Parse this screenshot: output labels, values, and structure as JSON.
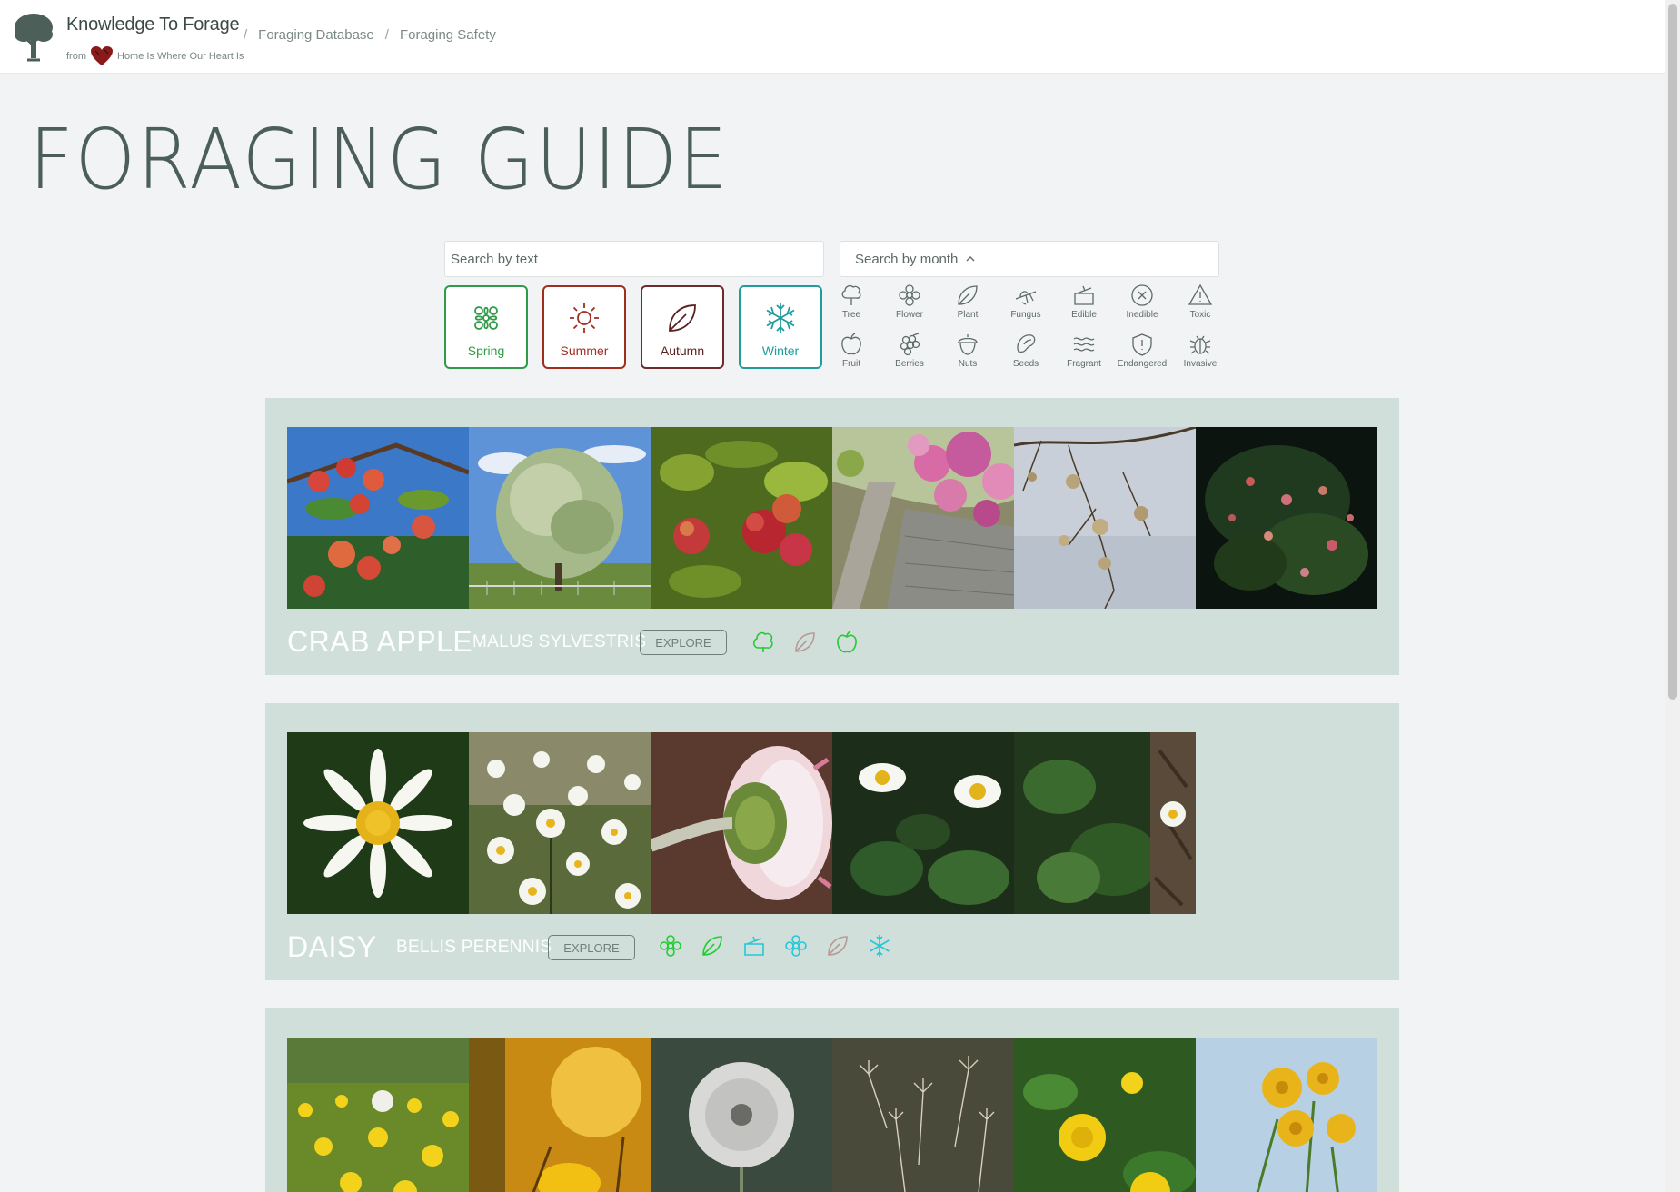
{
  "header": {
    "brand_title": "Knowledge To Forage",
    "brand_from": "from",
    "brand_parent": "Home Is Where Our Heart Is",
    "breadcrumbs": [
      "Foraging Database",
      "Foraging Safety"
    ]
  },
  "page": {
    "title": "FORAGING GUIDE"
  },
  "search": {
    "text_placeholder": "Search by text",
    "month_label": "Search by month"
  },
  "seasons": [
    {
      "label": "Spring",
      "color": "#2f9a47"
    },
    {
      "label": "Summer",
      "color": "#a02d1e"
    },
    {
      "label": "Autumn",
      "color": "#5a2020"
    },
    {
      "label": "Winter",
      "color": "#1f9c9c"
    }
  ],
  "categories": {
    "row1": [
      "Tree",
      "Flower",
      "Plant",
      "Fungus",
      "Edible",
      "Inedible",
      "Toxic"
    ],
    "row2": [
      "Fruit",
      "Berries",
      "Nuts",
      "Seeds",
      "Fragrant",
      "Endangered",
      "Invasive"
    ]
  },
  "plants": [
    {
      "name": "CRAB APPLE",
      "latin": "MALUS SYLVESTRIS",
      "explore_label": "EXPLORE",
      "tags": [
        "tree-icon",
        "leaf-icon",
        "apple-icon"
      ]
    },
    {
      "name": "DAISY",
      "latin": "BELLIS PERENNIS",
      "explore_label": "EXPLORE",
      "tags": [
        "flower-icon",
        "leaf-icon",
        "pot-icon",
        "flower-icon",
        "leaf-icon",
        "snowflake-icon"
      ]
    },
    {
      "name": "",
      "latin": "",
      "explore_label": ""
    }
  ],
  "colors": {
    "background": "#f2f3f4",
    "card": "#d1dfdb",
    "title": "#4b5f58",
    "tag_green": "#22cc33",
    "tag_cyan": "#22c8d8",
    "tag_muted": "#b89a95"
  }
}
